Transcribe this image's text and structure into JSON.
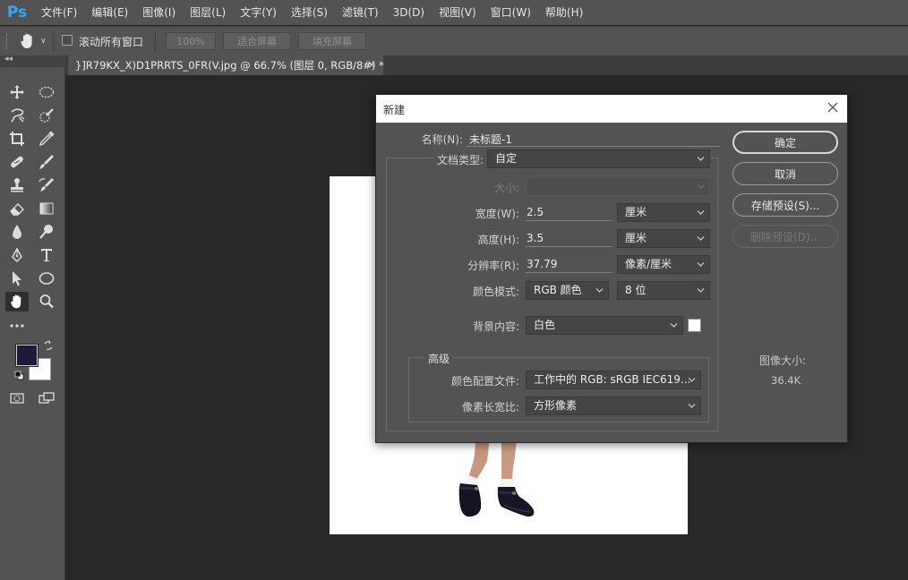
{
  "app": {
    "logo": "Ps",
    "menu": [
      "文件(F)",
      "编辑(E)",
      "图像(I)",
      "图层(L)",
      "文字(Y)",
      "选择(S)",
      "滤镜(T)",
      "3D(D)",
      "视图(V)",
      "窗口(W)",
      "帮助(H)"
    ]
  },
  "options_bar": {
    "tool_icon": "hand-icon",
    "scroll_all_label": "滚动所有窗口",
    "scroll_all_checked": false,
    "zoom_button": "100%",
    "fit_screen_button": "适合屏幕",
    "fill_screen_button": "填充屏幕"
  },
  "document_tab": {
    "title": "}]R79KX_X)D1PRRTS_0FR(V.jpg @ 66.7% (图层 0, RGB/8#) *",
    "close": "×"
  },
  "tools": [
    "move-icon",
    "elliptical-marquee-icon",
    "lasso-icon",
    "quick-selection-icon",
    "crop-icon",
    "eyedropper-icon",
    "healing-brush-icon",
    "brush-icon",
    "clone-stamp-icon",
    "history-brush-icon",
    "eraser-icon",
    "gradient-icon",
    "blur-icon",
    "dodge-icon",
    "pen-icon",
    "type-icon",
    "path-selection-icon",
    "ellipse-icon",
    "hand-icon",
    "zoom-icon",
    "more-tools-icon"
  ],
  "colors": {
    "foreground": "#1d1a3c",
    "background": "#ffffff",
    "ps_blue": "#31a8ff"
  },
  "dialog": {
    "title": "新建",
    "name_label": "名称(N):",
    "name_value": "未标题-1",
    "doc_type_label": "文档类型:",
    "doc_type_value": "自定",
    "size_label": "大小:",
    "size_value": "",
    "width_label": "宽度(W):",
    "width_value": "2.5",
    "width_unit": "厘米",
    "height_label": "高度(H):",
    "height_value": "3.5",
    "height_unit": "厘米",
    "resolution_label": "分辨率(R):",
    "resolution_value": "37.79",
    "resolution_unit": "像素/厘米",
    "color_mode_label": "颜色模式:",
    "color_mode_value": "RGB 颜色",
    "bit_depth_value": "8 位",
    "bg_content_label": "背景内容:",
    "bg_content_value": "白色",
    "advanced_label": "高级",
    "color_profile_label": "颜色配置文件:",
    "color_profile_value": "工作中的 RGB: sRGB IEC619...",
    "pixel_aspect_label": "像素长宽比:",
    "pixel_aspect_value": "方形像素",
    "ok_button": "确定",
    "cancel_button": "取消",
    "save_preset_button": "存储预设(S)...",
    "delete_preset_button": "删除预设(D)...",
    "image_size_label": "图像大小:",
    "image_size_value": "36.4K"
  }
}
